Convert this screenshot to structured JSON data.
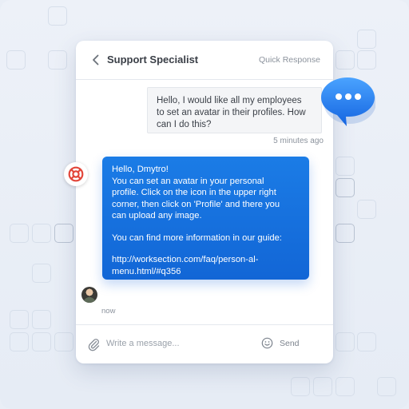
{
  "header": {
    "title": "Support Specialist",
    "quick_response": "Quick Response"
  },
  "messages": {
    "user": {
      "lines": [
        "Hello, I would like all my employees",
        "to set an avatar in their profiles. How",
        "can I do this?"
      ],
      "time": "5 minutes ago"
    },
    "agent": {
      "lines": [
        "Hello, Dmytro!",
        "You can set an avatar in your personal",
        "profile. Click on the icon in the upper right",
        "corner, then click on 'Profile' and there you",
        "can upload any image.",
        "",
        "You can find more information in our guide:",
        "",
        "http://worksection.com/faq/person-al-",
        "menu.html/#q356"
      ],
      "time": "now"
    }
  },
  "composer": {
    "placeholder": "Write a message...",
    "send_label": "Send"
  },
  "colors": {
    "accent": "#1a73e8",
    "support_icon": "#e2463a",
    "background": "#e9eef6"
  },
  "icons": {
    "back": "chevron-left-icon",
    "support": "lifebuoy-icon",
    "attach": "paperclip-icon",
    "emoji": "smiley-icon",
    "chat": "chat-bubble-icon"
  }
}
